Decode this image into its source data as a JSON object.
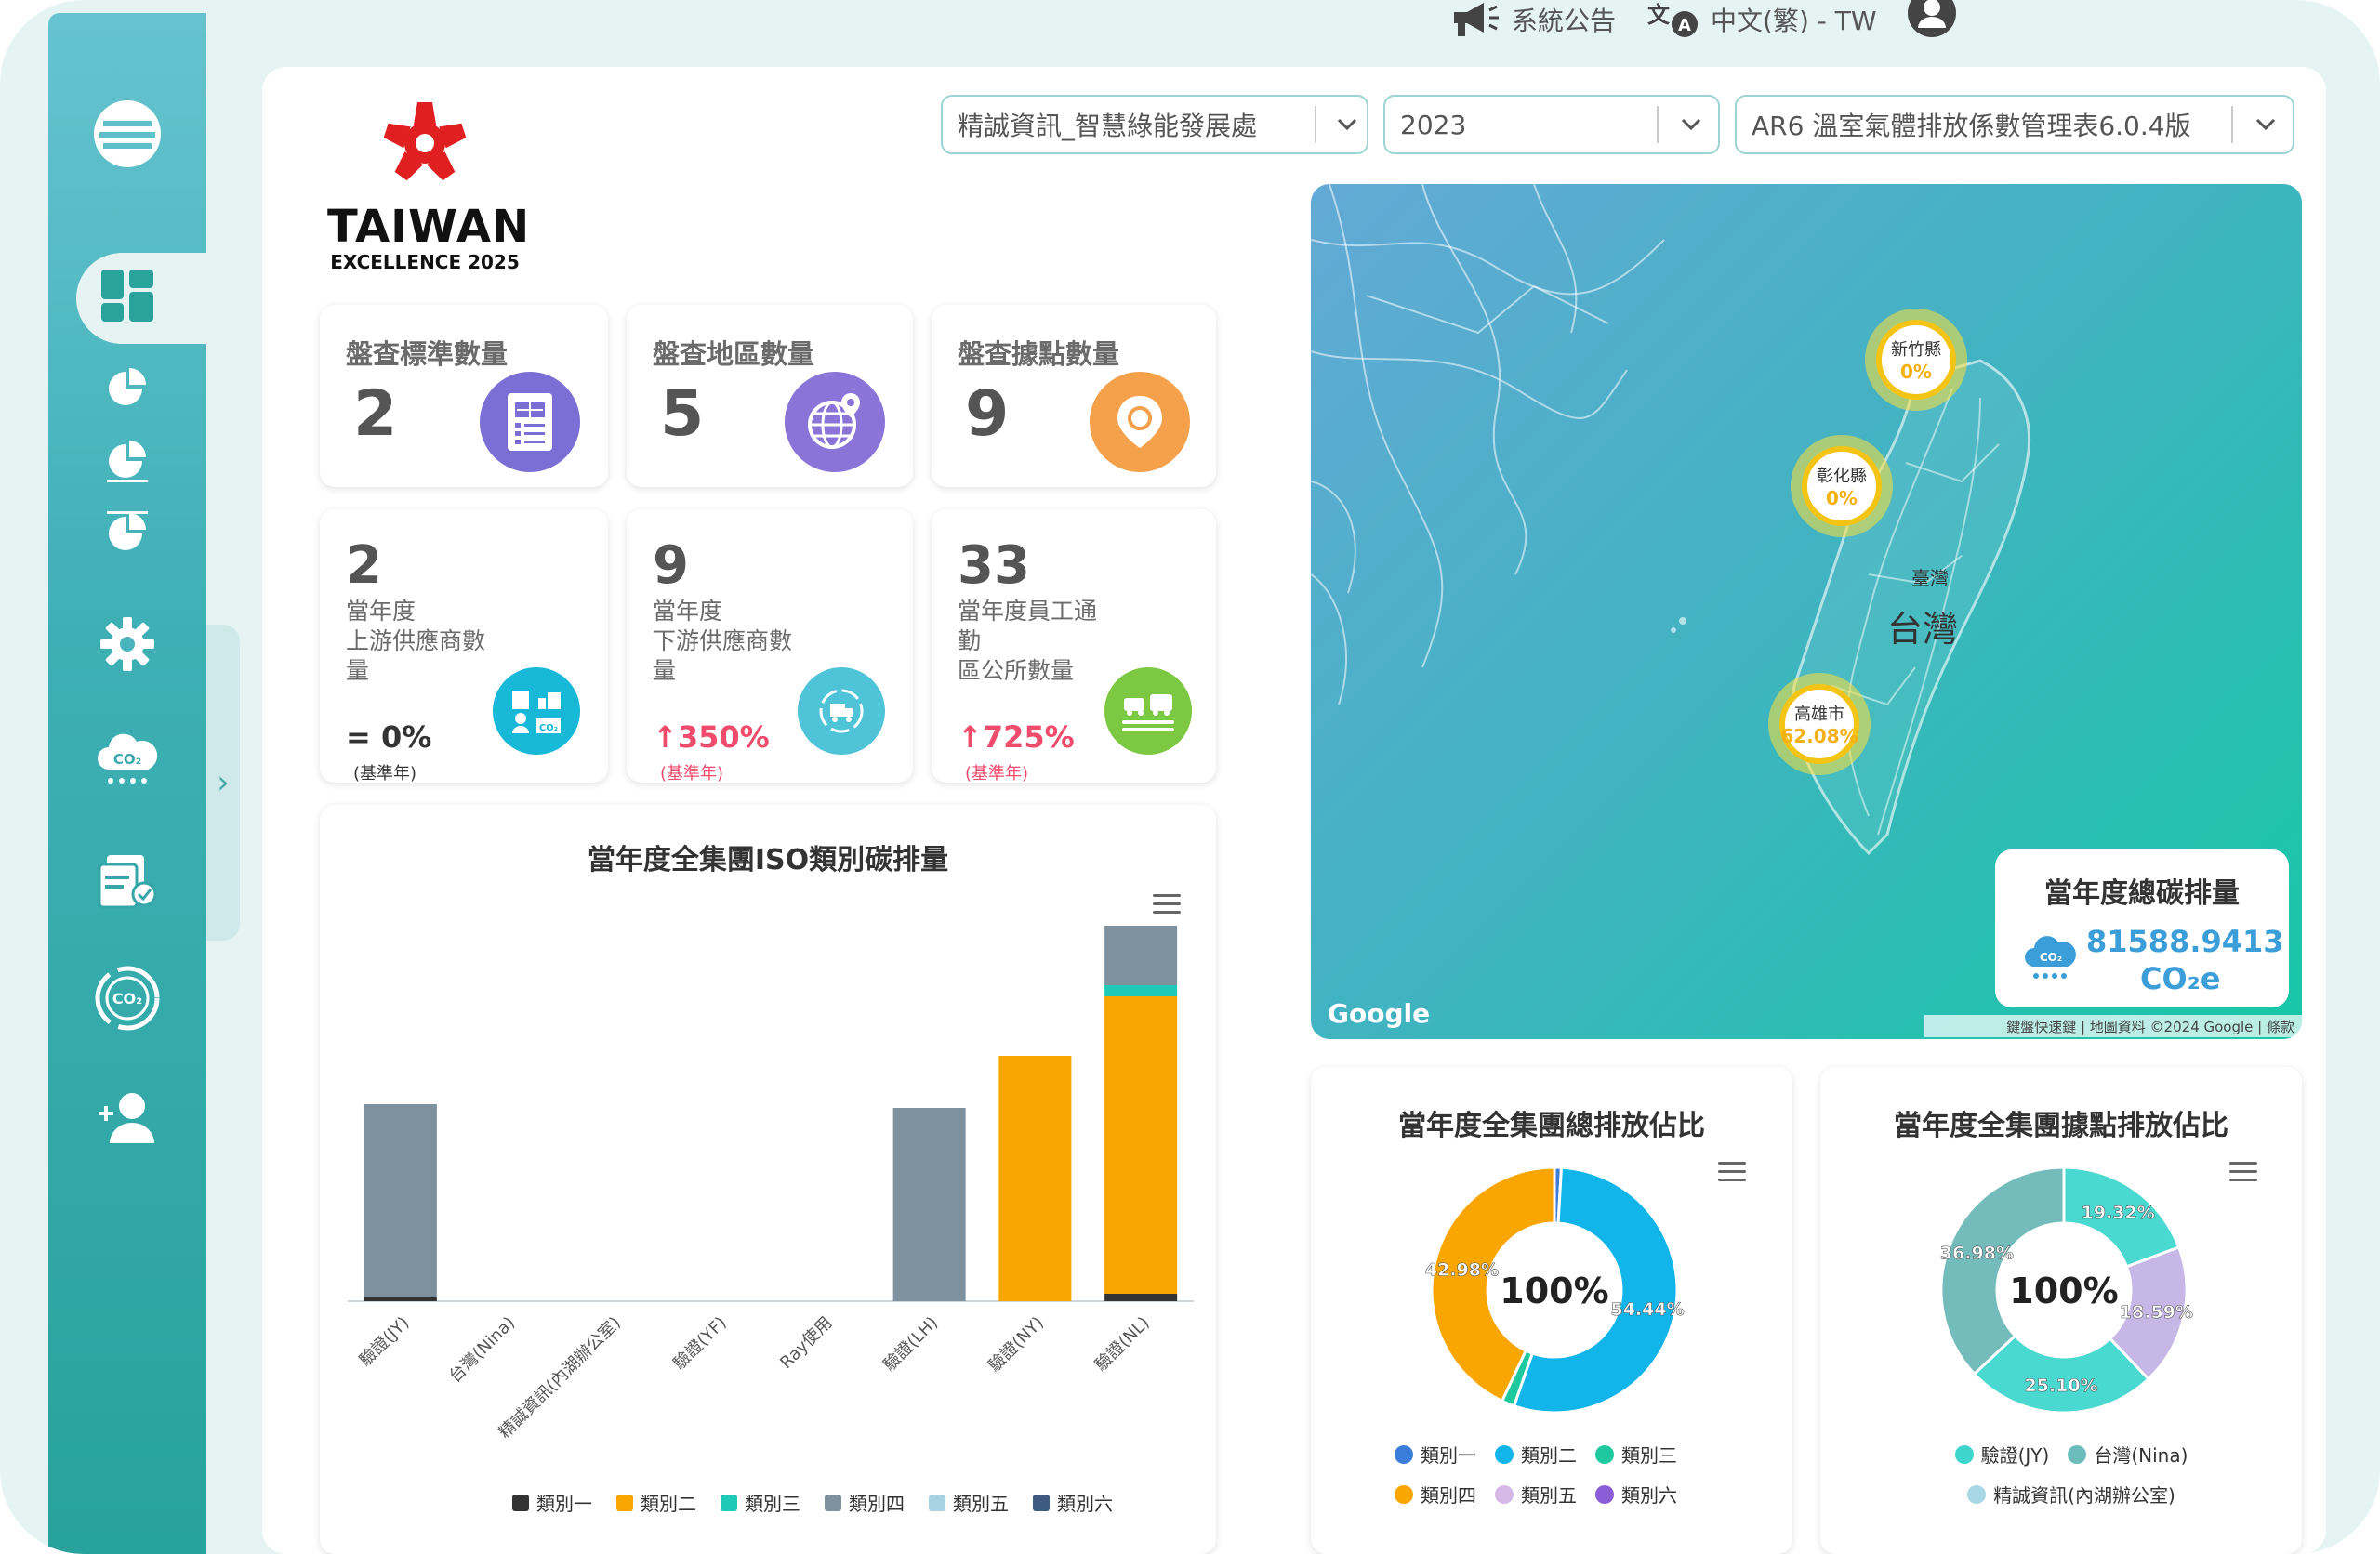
{
  "topbar": {
    "announcement": "系統公告",
    "language": "中文(繁) - TW"
  },
  "logo": {
    "title": "TAIWAN",
    "subtitle": "EXCELLENCE 2025"
  },
  "filters": {
    "company": "精誠資訊_智慧綠能發展處",
    "year": "2023",
    "factor_table": "AR6 溫室氣體排放係數管理表6.0.4版"
  },
  "stats": [
    {
      "title": "盤查標準數量",
      "value": "2",
      "icon": "checklist-icon",
      "color": "#7b6fd6"
    },
    {
      "title": "盤查地區數量",
      "value": "5",
      "icon": "globe-pin-icon",
      "color": "#8a74d8"
    },
    {
      "title": "盤查據點數量",
      "value": "9",
      "icon": "location-pin-icon",
      "color": "#f5a04a"
    }
  ],
  "stats2": [
    {
      "value": "2",
      "label": "當年度\n上游供應商數量",
      "change": "= 0%",
      "base": "(基準年)",
      "trend": "equal",
      "icon": "supplier-icon",
      "color": "#17b8d8"
    },
    {
      "value": "9",
      "label": "當年度\n下游供應商數量",
      "change": "↑350%",
      "base": "(基準年)",
      "trend": "up",
      "icon": "delivery-icon",
      "color": "#4fc3d8"
    },
    {
      "value": "33",
      "label": "當年度員工通勤\n區公所數量",
      "change": "↑725%",
      "base": "(基準年)",
      "trend": "up",
      "icon": "commute-icon",
      "color": "#7cc843"
    }
  ],
  "map": {
    "google_label": "Google",
    "attribution": "鍵盤快速鍵 | 地圖資料 ©2024 Google | 條款",
    "island_label_small": "臺灣",
    "island_label": "台灣",
    "pins": [
      {
        "name": "新竹縣",
        "value": "0%"
      },
      {
        "name": "彰化縣",
        "value": "0%"
      },
      {
        "name": "高雄市",
        "value": "62.08%"
      }
    ],
    "total": {
      "title": "當年度總碳排量",
      "value": "81588.9413",
      "unit": "CO₂e"
    }
  },
  "chart_data": [
    {
      "type": "bar",
      "title": "當年度全集團ISO類別碳排量",
      "categories": [
        "驗證(JY)",
        "台灣(Nina)",
        "精誠資訊(內湖辦公室)",
        "驗證(YF)",
        "Ray使用",
        "驗證(LH)",
        "驗證(NY)",
        "驗證(NL)"
      ],
      "series": [
        {
          "name": "類別一",
          "color": "#333333",
          "values": [
            1,
            0,
            0,
            0,
            0,
            0,
            0,
            2
          ]
        },
        {
          "name": "類別二",
          "color": "#f9a603",
          "values": [
            0,
            0,
            0,
            0,
            0,
            0,
            66,
            80
          ]
        },
        {
          "name": "類別三",
          "color": "#1fc9b8",
          "values": [
            0,
            0,
            0,
            0,
            0,
            0,
            0,
            3
          ]
        },
        {
          "name": "類別四",
          "color": "#7d929e",
          "values": [
            52,
            0,
            0,
            0,
            0,
            52,
            0,
            16
          ]
        },
        {
          "name": "類別五",
          "color": "#a9d3e2",
          "values": [
            0,
            0,
            0,
            0,
            0,
            0,
            0,
            0
          ]
        },
        {
          "name": "類別六",
          "color": "#3d5a80",
          "values": [
            0,
            0,
            0,
            0,
            0,
            0,
            0,
            0
          ]
        }
      ],
      "ylim": [
        0,
        110
      ]
    },
    {
      "type": "pie",
      "title": "當年度全集團總排放佔比",
      "center_label": "100%",
      "labels": [
        "類別一",
        "類別二",
        "類別三",
        "類別四",
        "類別五",
        "類別六"
      ],
      "colors": [
        "#3b7dd8",
        "#12b5ea",
        "#1fc9a0",
        "#f9a603",
        "#d6b8e6",
        "#8a5cd6"
      ],
      "values": [
        0.9,
        54.44,
        1.68,
        42.98,
        0,
        0
      ],
      "data_labels": [
        "",
        "54.44%",
        "",
        "42.98%",
        "",
        ""
      ]
    },
    {
      "type": "pie",
      "title": "當年度全集團據點排放佔比",
      "center_label": "100%",
      "labels": [
        "驗證(JY)",
        "台灣(Nina)",
        "精誠資訊(內湖辦公室)"
      ],
      "legend_labels": [
        "驗證(JY)",
        "台灣(Nina)",
        "精誠資訊(內湖辦公室)"
      ],
      "colors": [
        "#3ed6cc",
        "#6cbcbc",
        "#a8d7e6"
      ],
      "slice_colors": [
        "#4ad9d0",
        "#c7b7e6",
        "#4ad9d0",
        "#74bcbc"
      ],
      "values": [
        19.32,
        18.59,
        25.1,
        36.98
      ],
      "data_labels": [
        "19.32%",
        "18.59%",
        "25.10%",
        "36.98%"
      ]
    }
  ]
}
